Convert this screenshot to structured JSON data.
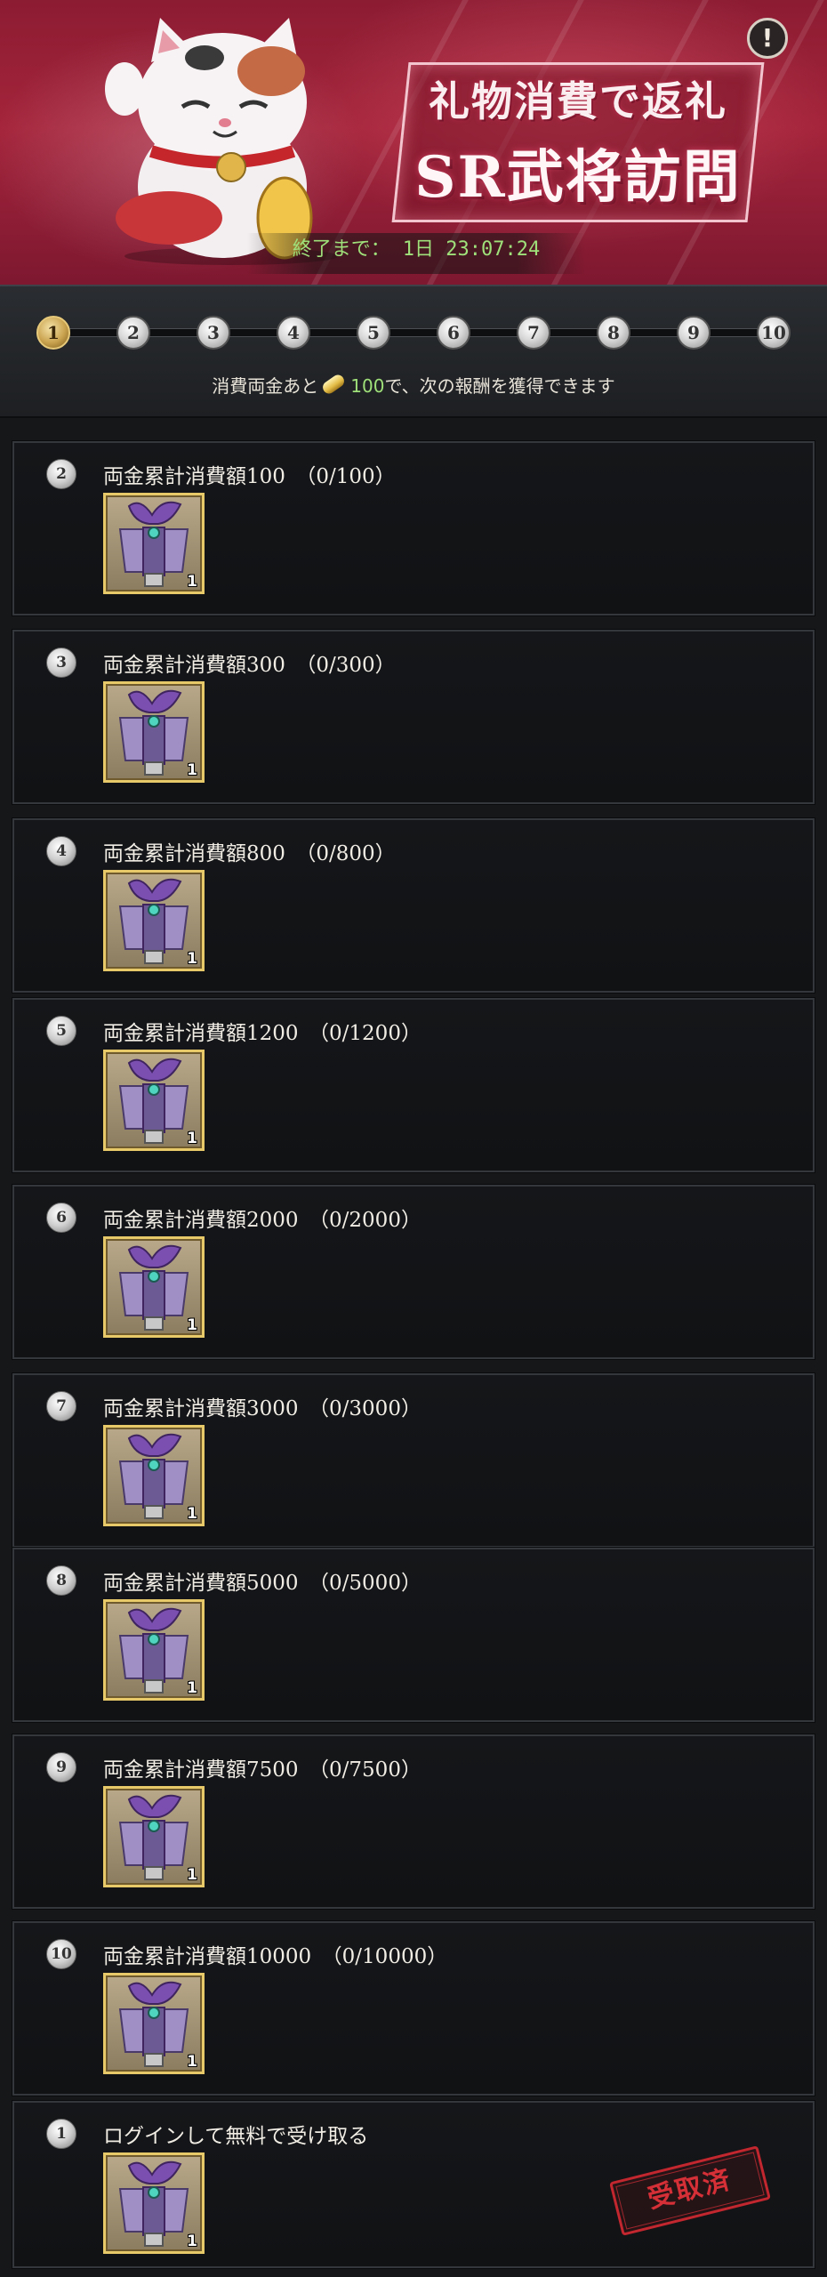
{
  "banner": {
    "title_line1": "礼物消費で返礼",
    "title_line2": "SR武将訪問",
    "countdown_label": "終了まで：",
    "countdown_value": "1日 23:07:24"
  },
  "progress": {
    "steps": [
      "1",
      "2",
      "3",
      "4",
      "5",
      "6",
      "7",
      "8",
      "9",
      "10"
    ],
    "current_step": 1,
    "message_prefix": "消費両金あと",
    "message_amount": "100",
    "message_suffix": "で、次の報酬を獲得できます"
  },
  "rewards": [
    {
      "num": "2",
      "title": "両金累計消費額100　（0/100）",
      "qty": "1"
    },
    {
      "num": "3",
      "title": "両金累計消費額300　（0/300）",
      "qty": "1"
    },
    {
      "num": "4",
      "title": "両金累計消費額800　（0/800）",
      "qty": "1"
    },
    {
      "num": "5",
      "title": "両金累計消費額1200　（0/1200）",
      "qty": "1"
    },
    {
      "num": "6",
      "title": "両金累計消費額2000　（0/2000）",
      "qty": "1"
    },
    {
      "num": "7",
      "title": "両金累計消費額3000　（0/3000）",
      "qty": "1"
    },
    {
      "num": "8",
      "title": "両金累計消費額5000　（0/5000）",
      "qty": "1"
    },
    {
      "num": "9",
      "title": "両金累計消費額7500　（0/7500）",
      "qty": "1"
    },
    {
      "num": "10",
      "title": "両金累計消費額10000　（0/10000）",
      "qty": "1"
    },
    {
      "num": "1",
      "title": "ログインして無料で受け取る",
      "qty": "1",
      "stamp": "受取済"
    }
  ],
  "colors": {
    "banner": "#a4243b",
    "accent_green": "#9fe07a",
    "item_frame": "#e7c96a",
    "stamp_red": "#c2262e"
  },
  "icons": {
    "info": "exclamation-circle-icon",
    "currency": "gold-coin-icon",
    "reward_item": "purple-gift-bundle-icon",
    "mascot": "lucky-cat-icon"
  }
}
